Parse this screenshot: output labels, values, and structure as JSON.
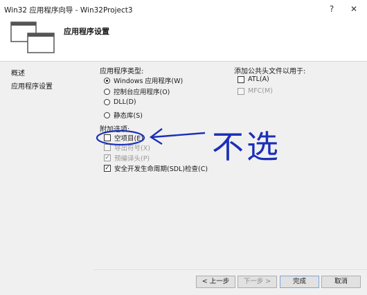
{
  "window": {
    "title": "Win32 应用程序向导 - Win32Project3",
    "help_glyph": "?",
    "close_glyph": "✕"
  },
  "header": {
    "page_title": "应用程序设置"
  },
  "sidebar": {
    "items": [
      {
        "label": "概述"
      },
      {
        "label": "应用程序设置"
      }
    ]
  },
  "app_type": {
    "label": "应用程序类型:",
    "options": [
      {
        "label": "Windows 应用程序(W)",
        "selected": true
      },
      {
        "label": "控制台应用程序(O)",
        "selected": false
      },
      {
        "label": "DLL(D)",
        "selected": false
      },
      {
        "label": "静态库(S)",
        "selected": false
      }
    ]
  },
  "common_headers": {
    "label": "添加公共头文件以用于:",
    "options": [
      {
        "label": "ATL(A)",
        "checked": false,
        "disabled": false
      },
      {
        "label": "MFC(M)",
        "checked": false,
        "disabled": true
      }
    ]
  },
  "additional": {
    "label": "附加选项:",
    "options": [
      {
        "label": "空项目(E)",
        "checked": false,
        "disabled": false
      },
      {
        "label": "导出符号(X)",
        "checked": false,
        "disabled": true
      },
      {
        "label": "预编译头(P)",
        "checked": true,
        "disabled": true
      },
      {
        "label": "安全开发生命周期(SDL)检查(C)",
        "checked": true,
        "disabled": false
      }
    ]
  },
  "annotation": {
    "text": "不选",
    "color": "#1b2fb8"
  },
  "buttons": {
    "prev": "< 上一步",
    "next": "下一步 >",
    "finish": "完成",
    "cancel": "取消"
  }
}
